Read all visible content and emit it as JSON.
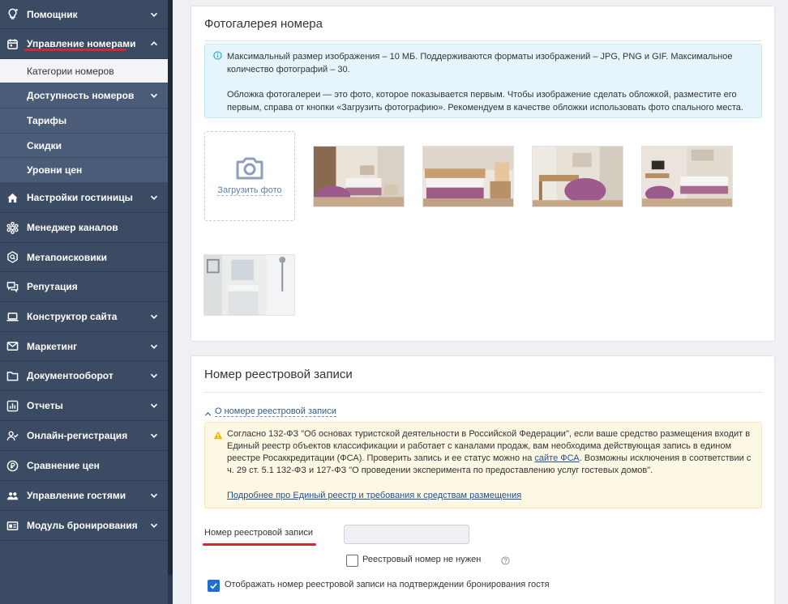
{
  "sidebar": {
    "items": [
      {
        "label": "Помощник",
        "icon": "lightbulb-icon"
      },
      {
        "label": "Управление номерами",
        "icon": "calendar-icon"
      },
      {
        "label": "Настройки гостиницы",
        "icon": "home-icon"
      },
      {
        "label": "Менеджер каналов",
        "icon": "gear-network-icon"
      },
      {
        "label": "Метапоисковики",
        "icon": "search-icon"
      },
      {
        "label": "Репутация",
        "icon": "chat-icon"
      },
      {
        "label": "Конструктор сайта",
        "icon": "laptop-icon"
      },
      {
        "label": "Маркетинг",
        "icon": "mail-icon"
      },
      {
        "label": "Документооборот",
        "icon": "folder-icon"
      },
      {
        "label": "Отчеты",
        "icon": "bar-chart-icon"
      },
      {
        "label": "Онлайн-регистрация",
        "icon": "user-check-icon"
      },
      {
        "label": "Сравнение цен",
        "icon": "currency-icon"
      },
      {
        "label": "Управление гостями",
        "icon": "users-icon"
      },
      {
        "label": "Модуль бронирования",
        "icon": "booking-icon"
      }
    ],
    "subitems": [
      {
        "label": "Категории номеров"
      },
      {
        "label": "Доступность номеров"
      },
      {
        "label": "Тарифы"
      },
      {
        "label": "Скидки"
      },
      {
        "label": "Уровни цен"
      }
    ]
  },
  "gallery": {
    "title": "Фотогалерея номера",
    "info_line1": "Максимальный размер изображения – 10 МБ. Поддерживаются форматы изображений – JPG, PNG и GIF. Максимальное количество фотографий – 30.",
    "info_line2": "Обложка фотогалереи — это фото, которое показывается первым. Чтобы изображение сделать обложкой, разместите его первым, справа от кнопки «Загрузить фотографию». Рекомендуем в качестве обложки использовать фото спального места.",
    "upload_label": "Загрузить фото"
  },
  "registry": {
    "title": "Номер реестровой записи",
    "toggle_label": "О номере реестровой записи",
    "warn_text_before": "Согласно 132-ФЗ \"Об основах туристской деятельности в Российской Федерации\", если ваше средство размещения входит в Единый реестр объектов классификации и работает с каналами продаж, вам необходима действующая запись в едином реестре Росаккредитации (ФСА). Проверить запись и ее статус можно на ",
    "warn_link": "сайте ФСА",
    "warn_text_after": ". Возможны исключения в соответствии с ч. 29 ст. 5.1 132-ФЗ и 127-ФЗ \"О проведении эксперимента по предоставлению услуг гостевых домов\".",
    "more_link": "Подробнее про Единый реестр и требования к средствам размещения",
    "field_label": "Номер реестровой записи",
    "field_value": "",
    "not_needed_label": "Реестровый номер не нужен",
    "show_label": "Отображать номер реестровой записи на подтверждении бронирования гостя"
  }
}
